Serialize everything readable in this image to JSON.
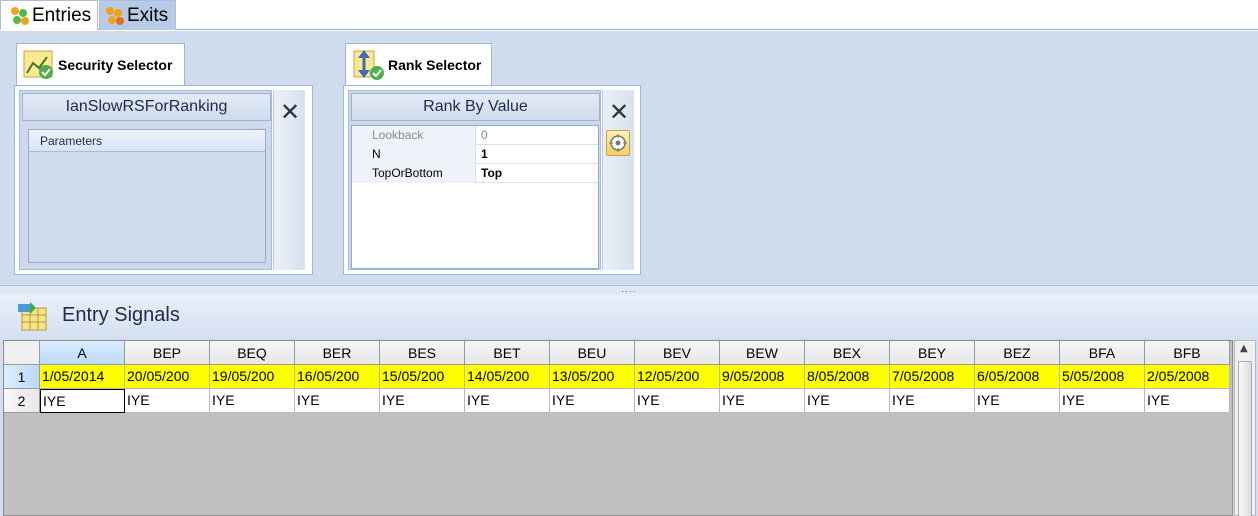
{
  "tabs": [
    {
      "label": "Entries",
      "icon": "green-orange-dots-icon"
    },
    {
      "label": "Exits",
      "icon": "orange-dots-icon"
    }
  ],
  "security_selector": {
    "tab_label": "Security Selector",
    "header": "IanSlowRSForRanking",
    "params_label": "Parameters"
  },
  "rank_selector": {
    "tab_label": "Rank Selector",
    "header": "Rank By Value",
    "properties": [
      {
        "name": "Lookback",
        "value": "0"
      },
      {
        "name": "N",
        "value": "1"
      },
      {
        "name": "TopOrBottom",
        "value": "Top"
      }
    ]
  },
  "splitter_grip": "....",
  "entry_signals": {
    "title": "Entry Signals",
    "columns": [
      "A",
      "BEP",
      "BEQ",
      "BER",
      "BES",
      "BET",
      "BEU",
      "BEV",
      "BEW",
      "BEX",
      "BEY",
      "BEZ",
      "BFA",
      "BFB"
    ],
    "rows": [
      {
        "label": "1",
        "cells": [
          "1/05/2014",
          "20/05/200",
          "19/05/200",
          "16/05/200",
          "15/05/200",
          "14/05/200",
          "13/05/200",
          "12/05/200",
          "9/05/2008",
          "8/05/2008",
          "7/05/2008",
          "6/05/2008",
          "5/05/2008",
          "2/05/2008"
        ]
      },
      {
        "label": "2",
        "cells": [
          "IYE",
          "IYE",
          "IYE",
          "IYE",
          "IYE",
          "IYE",
          "IYE",
          "IYE",
          "IYE",
          "IYE",
          "IYE",
          "IYE",
          "IYE",
          "IYE"
        ]
      }
    ]
  },
  "colors": {
    "highlight": "#ffff00",
    "panel_bg": "#cfdced"
  }
}
